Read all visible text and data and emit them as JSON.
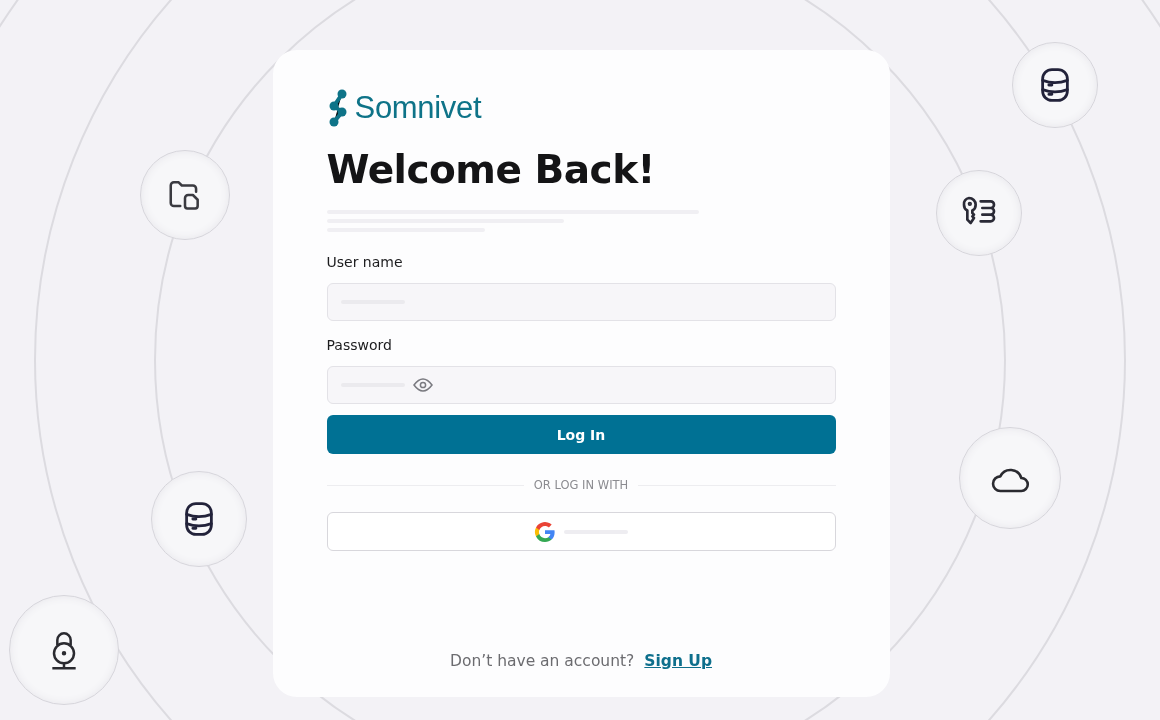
{
  "brand": {
    "name": "Somnivet"
  },
  "heading": "Welcome Back!",
  "fields": [
    {
      "label": "User name",
      "kind": "text"
    },
    {
      "label": "Password",
      "kind": "password"
    }
  ],
  "login_button": "Log In",
  "divider": "OR LOG IN WITH",
  "footer": {
    "prompt": "Don’t have an account?",
    "link": "Sign Up"
  }
}
